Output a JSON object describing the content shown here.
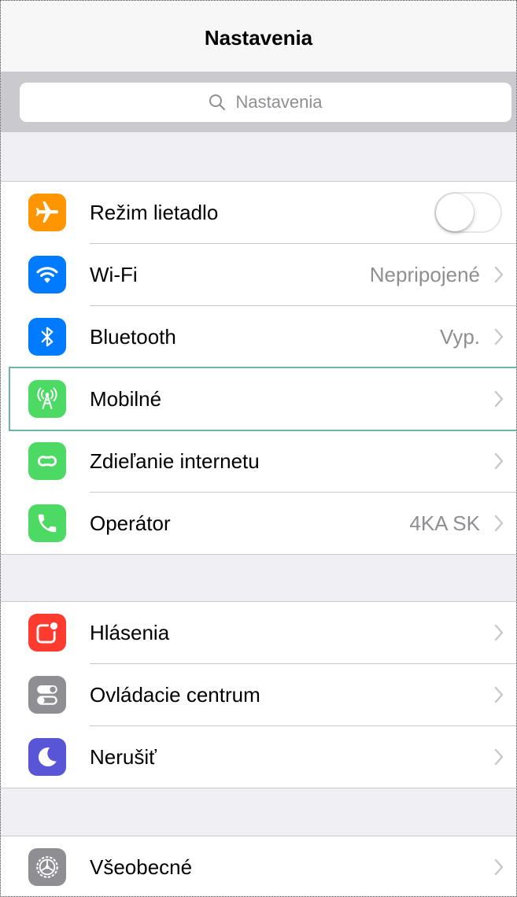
{
  "nav": {
    "title": "Nastavenia"
  },
  "search": {
    "placeholder": "Nastavenia"
  },
  "colors": {
    "orange": "#ff9500",
    "blue": "#007aff",
    "green": "#4cd964",
    "red": "#ff3b30",
    "gray": "#8e8e93",
    "purple": "#5856d6"
  },
  "group1": [
    {
      "label": "Režim lietadlo",
      "icon": "airplane-icon",
      "toggle_on": false
    },
    {
      "label": "Wi-Fi",
      "icon": "wifi-icon",
      "value": "Nepripojené"
    },
    {
      "label": "Bluetooth",
      "icon": "bluetooth-icon",
      "value": "Vyp."
    },
    {
      "label": "Mobilné",
      "icon": "antenna-icon",
      "value": ""
    },
    {
      "label": "Zdieľanie internetu",
      "icon": "hotspot-icon",
      "value": ""
    },
    {
      "label": "Operátor",
      "icon": "phone-icon",
      "value": "4KA SK"
    }
  ],
  "group2": [
    {
      "label": "Hlásenia",
      "icon": "notifications-icon"
    },
    {
      "label": "Ovládacie centrum",
      "icon": "control-center-icon"
    },
    {
      "label": "Nerušiť",
      "icon": "moon-icon"
    }
  ],
  "group3": [
    {
      "label": "Všeobecné",
      "icon": "gear-icon"
    }
  ]
}
